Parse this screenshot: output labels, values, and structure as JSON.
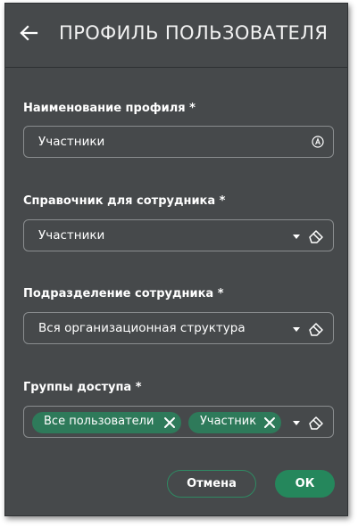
{
  "header": {
    "title": "ПРОФИЛЬ ПОЛЬЗОВАТЕЛЯ",
    "back_icon": "arrow-left-icon"
  },
  "fields": {
    "profile_name": {
      "label": "Наименование профиля *",
      "value": "Участники",
      "icon": "circle-a-icon"
    },
    "employee_directory": {
      "label": "Справочник для сотрудника *",
      "value": "Участники"
    },
    "employee_department": {
      "label": "Подразделение сотрудника *",
      "value": "Вся организационная структура"
    },
    "access_groups": {
      "label": "Группы доступа *",
      "chips": [
        "Все пользователи",
        "Участник"
      ]
    }
  },
  "buttons": {
    "cancel_label": "Отмена",
    "ok_label": "ОК"
  },
  "colors": {
    "background": "#46494b",
    "accent": "#25875c",
    "chip": "#2e7a5a"
  }
}
